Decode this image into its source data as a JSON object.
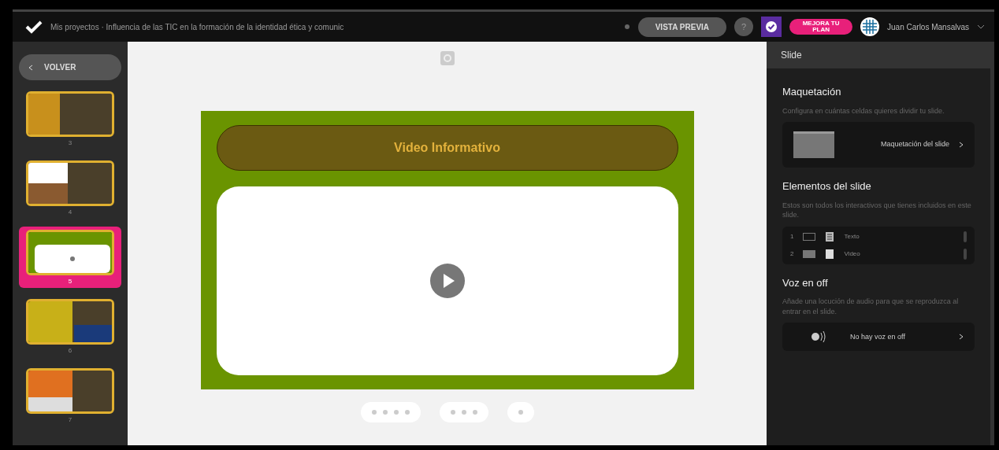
{
  "topbar": {
    "breadcrumb": "Mis proyectos · Influencia de las TIC en la formación de la identidad ética y comunic",
    "preview_button": "VISTA PREVIA",
    "help_button": "?",
    "upgrade_button": "MEJORA TU PLAN",
    "user_name": "Juan Carlos Mansalvas"
  },
  "sidebar": {
    "back_button": "VOLVER",
    "slides": [
      {
        "number": "3",
        "selected": false,
        "kind": "text-left"
      },
      {
        "number": "4",
        "selected": false,
        "kind": "image-left"
      },
      {
        "number": "5",
        "selected": true,
        "kind": "video"
      },
      {
        "number": "6",
        "selected": false,
        "kind": "text-two"
      },
      {
        "number": "7",
        "selected": false,
        "kind": "photo-left"
      }
    ]
  },
  "slide": {
    "title": "Video Informativo"
  },
  "panel": {
    "header": "Slide",
    "layout": {
      "heading": "Maquetación",
      "description": "Configura en cuántas celdas quieres dividir tu slide.",
      "button": "Maquetación del slide"
    },
    "elements": {
      "heading": "Elementos del slide",
      "description": "Estos son todos los interactivos que tienes incluidos en este slide.",
      "items": [
        {
          "number": "1",
          "kind": "text",
          "label": "Texto"
        },
        {
          "number": "2",
          "kind": "video",
          "label": "Video"
        }
      ]
    },
    "voiceover": {
      "heading": "Voz en off",
      "description": "Añade una locución de audio para que se reproduzca al entrar en el slide.",
      "button": "No hay voz en off"
    }
  }
}
